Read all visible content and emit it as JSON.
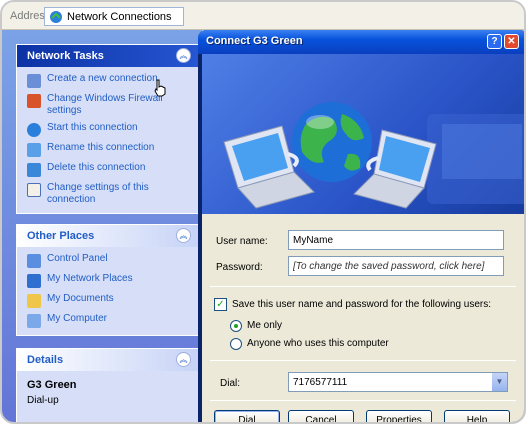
{
  "address": {
    "label": "Address",
    "value": "Network Connections",
    "icon": "network-connections-icon"
  },
  "tasks": {
    "network_tasks": {
      "title": "Network Tasks",
      "items": [
        {
          "label": "Create a new connection",
          "icon": "new-connection-icon"
        },
        {
          "label": "Change Windows Firewall settings",
          "icon": "firewall-icon"
        },
        {
          "label": "Start this connection",
          "icon": "start-connection-icon"
        },
        {
          "label": "Rename this connection",
          "icon": "rename-icon"
        },
        {
          "label": "Delete this connection",
          "icon": "delete-icon"
        },
        {
          "label": "Change settings of this connection",
          "icon": "settings-icon"
        }
      ]
    },
    "other_places": {
      "title": "Other Places",
      "items": [
        {
          "label": "Control Panel",
          "icon": "control-panel-icon"
        },
        {
          "label": "My Network Places",
          "icon": "network-places-icon"
        },
        {
          "label": "My Documents",
          "icon": "documents-icon"
        },
        {
          "label": "My Computer",
          "icon": "computer-icon"
        }
      ]
    },
    "details": {
      "title": "Details",
      "name": "G3 Green",
      "type": "Dial-up"
    }
  },
  "dialog": {
    "title": "Connect G3 Green",
    "help_glyph": "?",
    "close_glyph": "✕",
    "username_label": "User name:",
    "username_value": "MyName",
    "password_label": "Password:",
    "password_value": "[To change the saved password, click here]",
    "save_label": "Save this user name and password for the following users:",
    "radio_me": "Me only",
    "radio_anyone": "Anyone who uses this computer",
    "dial_label": "Dial:",
    "dial_value": "7176577111",
    "buttons": {
      "dial": "Dial",
      "cancel": "Cancel",
      "properties": "Properties",
      "help": "Help"
    }
  },
  "colors": {
    "xp_blue": "#0752db",
    "task_link": "#215dc6",
    "dialog_face": "#ece9d8"
  }
}
